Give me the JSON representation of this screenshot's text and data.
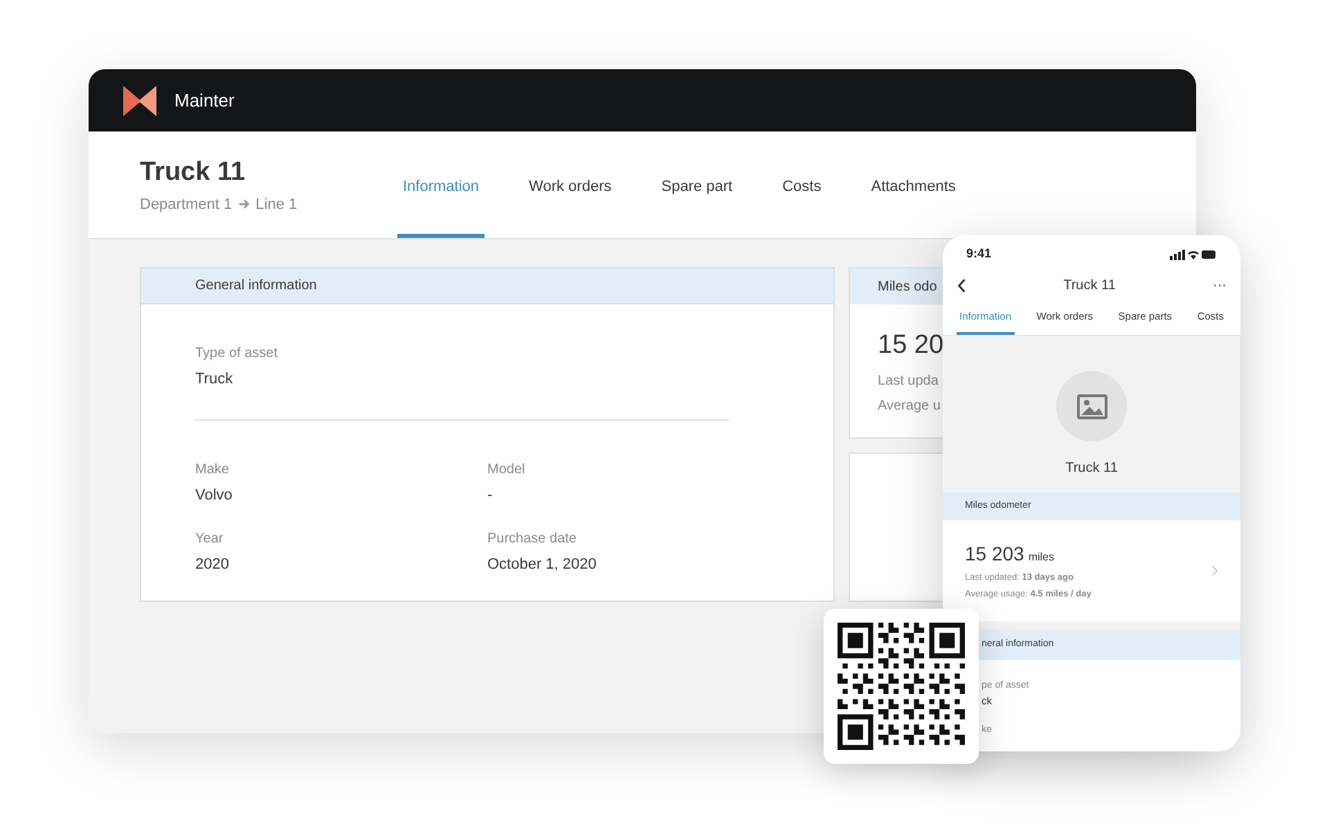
{
  "app": {
    "name": "Mainter"
  },
  "asset": {
    "title": "Truck 11",
    "breadcrumb": [
      "Department 1",
      "Line 1"
    ]
  },
  "tabs": [
    {
      "label": "Information",
      "selected": true
    },
    {
      "label": "Work orders",
      "selected": false
    },
    {
      "label": "Spare part",
      "selected": false
    },
    {
      "label": "Costs",
      "selected": false
    },
    {
      "label": "Attachments",
      "selected": false
    }
  ],
  "general_card": {
    "title": "General information",
    "top_fields": [
      {
        "label": "Type of asset",
        "value": "Truck"
      }
    ],
    "grid_fields": [
      {
        "label": "Make",
        "value": "Volvo"
      },
      {
        "label": "Model",
        "value": "-"
      },
      {
        "label": "Year",
        "value": "2020"
      },
      {
        "label": "Purchase date",
        "value": "October 1, 2020"
      }
    ]
  },
  "odometer_card": {
    "title": "Miles odo",
    "value": "15 20",
    "lines": [
      "Last upda",
      "Average u"
    ]
  },
  "phone": {
    "time": "9:41",
    "title": "Truck 11",
    "more": "···",
    "tabs": [
      {
        "label": "Information",
        "selected": true
      },
      {
        "label": "Work orders",
        "selected": false
      },
      {
        "label": "Spare parts",
        "selected": false
      },
      {
        "label": "Costs",
        "selected": false
      }
    ],
    "asset_name": "Truck 11",
    "odometer": {
      "title": "Miles odometer",
      "value": "15 203",
      "unit": "miles",
      "lines": [
        "Last updated: **13 days ago**",
        "Average usage: **4.5 miles / day**"
      ]
    },
    "general": {
      "title": "neral information",
      "fields": [
        {
          "label": "pe of asset",
          "value": "ck"
        },
        {
          "label": "ke"
        }
      ]
    }
  }
}
